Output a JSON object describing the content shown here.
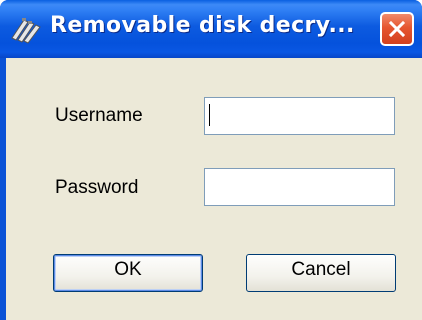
{
  "window": {
    "title": "Removable disk decry...",
    "close_icon": "close-x-icon",
    "app_icon": "usb-disk-icon"
  },
  "form": {
    "username_label": "Username",
    "username_value": "",
    "password_label": "Password",
    "password_value": ""
  },
  "buttons": {
    "ok_label": "OK",
    "cancel_label": "Cancel"
  },
  "colors": {
    "titlebar": "#0a52d6",
    "client_bg": "#ece9d8",
    "close_button": "#e6562f",
    "input_border": "#7f9db9"
  }
}
